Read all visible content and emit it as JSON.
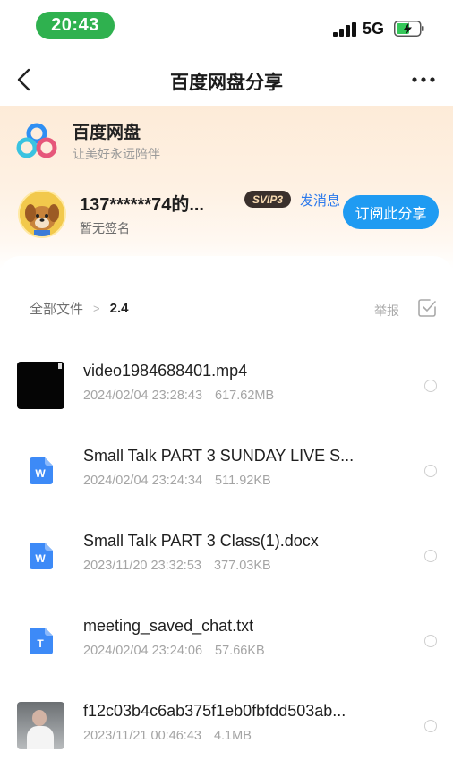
{
  "status_bar": {
    "time": "20:43",
    "network": "5G"
  },
  "nav": {
    "title": "百度网盘分享"
  },
  "brand": {
    "name": "百度网盘",
    "slogan": "让美好永远陪伴"
  },
  "sharer": {
    "name": "137******74的...",
    "badge": "SVIP3",
    "message_label": "发消息",
    "signature": "暂无签名",
    "subscribe_label": "订阅此分享"
  },
  "breadcrumb": {
    "root": "全部文件",
    "separator": ">",
    "current": "2.4"
  },
  "actions": {
    "report_label": "举报"
  },
  "files": [
    {
      "name": "video1984688401.mp4",
      "date": "2024/02/04 23:28:43",
      "size": "617.62MB",
      "icon": "video-thumbnail"
    },
    {
      "name": "Small Talk PART 3 SUNDAY LIVE S...",
      "date": "2024/02/04 23:24:34",
      "size": "511.92KB",
      "icon": "word-doc-icon",
      "icon_letter": "W"
    },
    {
      "name": "Small Talk PART 3 Class(1).docx",
      "date": "2023/11/20 23:32:53",
      "size": "377.03KB",
      "icon": "word-doc-icon",
      "icon_letter": "W"
    },
    {
      "name": "meeting_saved_chat.txt",
      "date": "2024/02/04 23:24:06",
      "size": "57.66KB",
      "icon": "text-file-icon",
      "icon_letter": "T"
    },
    {
      "name": "f12c03b4c6ab375f1eb0fbfdd503ab...",
      "date": "2023/11/21 00:46:43",
      "size": "4.1MB",
      "icon": "image-thumbnail"
    }
  ],
  "colors": {
    "accent": "#1f9bf2",
    "time_pill": "#2fb14f",
    "file_icon": "#3d8af7",
    "header_bg": "#fdebd8"
  }
}
